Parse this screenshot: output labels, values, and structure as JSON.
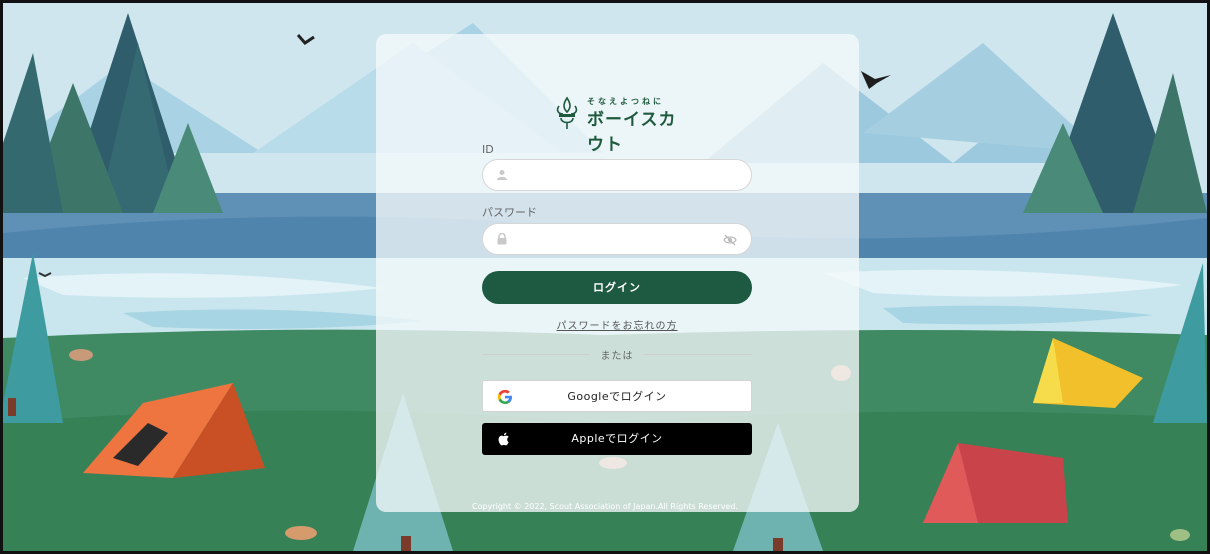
{
  "brand": {
    "tagline": "そなえよつねに",
    "name": "ボーイスカウト"
  },
  "form": {
    "id_label": "ID",
    "id_value": "",
    "password_label": "パスワード",
    "password_value": "",
    "login_label": "ログイン",
    "forgot_label": "パスワードをお忘れの方",
    "or_label": "または",
    "google_label": "Googleでログイン",
    "apple_label": "Appleでログイン"
  },
  "footer": {
    "copyright": "Copyright © 2022, Scout Association of Japan.All Rights Reserved."
  },
  "icons": {
    "user": "user-icon",
    "lock": "lock-icon",
    "eye_off": "eye-off-icon",
    "google": "google-icon",
    "apple": "apple-icon",
    "emblem": "scout-emblem-icon"
  },
  "colors": {
    "primary": "#1d5a41",
    "apple_button": "#000000",
    "google_button": "#ffffff"
  }
}
